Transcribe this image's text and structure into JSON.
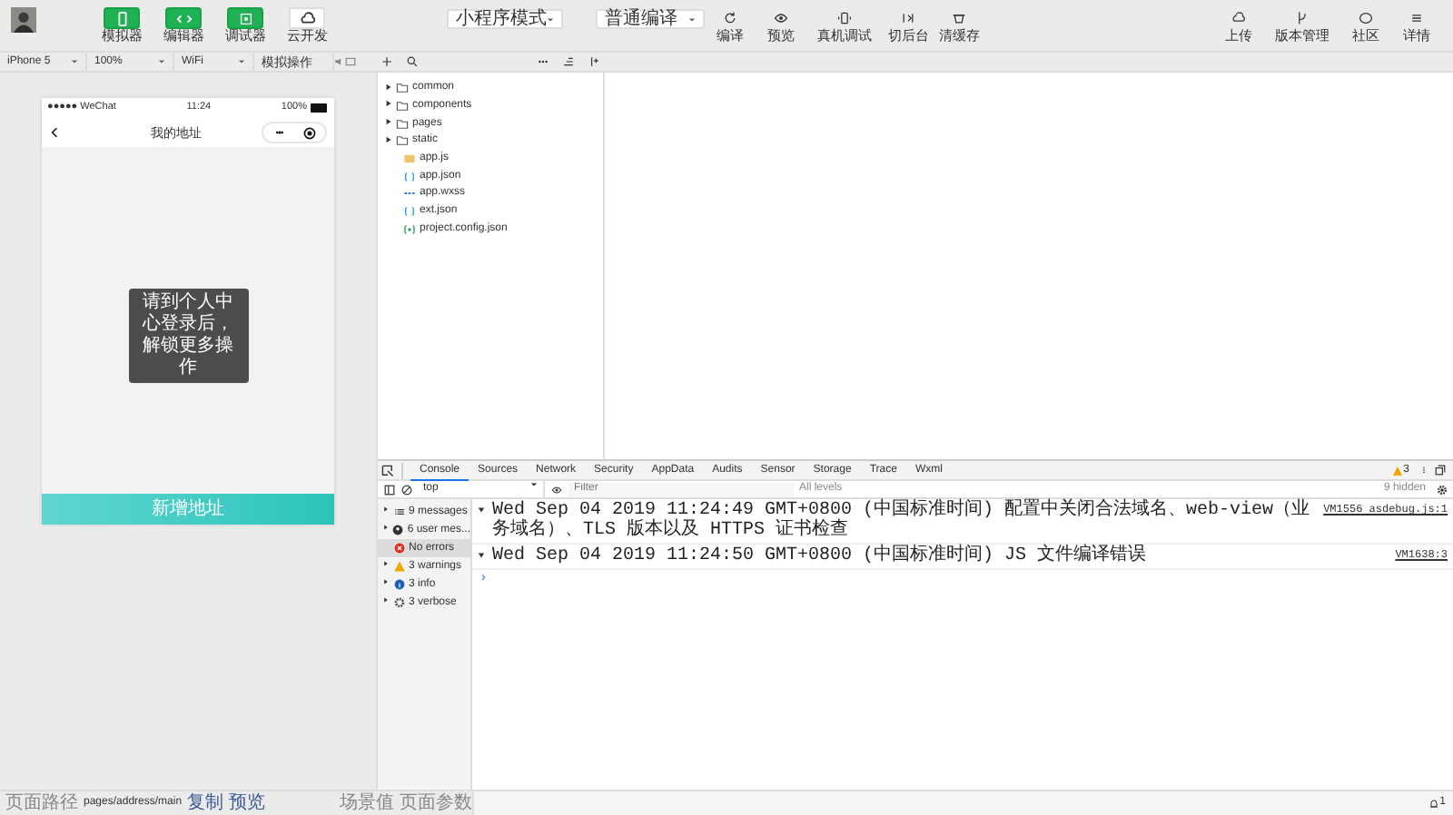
{
  "toolbar": {
    "views": [
      {
        "label": "模拟器",
        "on": true,
        "kind": "phone"
      },
      {
        "label": "编辑器",
        "on": true,
        "kind": "code"
      },
      {
        "label": "调试器",
        "on": true,
        "kind": "debug"
      },
      {
        "label": "云开发",
        "on": false,
        "kind": "cloud"
      }
    ],
    "mode": "小程序模式",
    "compile": "普通编译",
    "actions": [
      {
        "label": "编译",
        "kind": "refresh"
      },
      {
        "label": "预览",
        "kind": "eye"
      },
      {
        "label": "真机调试",
        "kind": "device"
      },
      {
        "label": "切后台",
        "kind": "switch"
      },
      {
        "label": "清缓存",
        "kind": "cache"
      }
    ],
    "right": [
      {
        "label": "上传",
        "kind": "upload"
      },
      {
        "label": "版本管理",
        "kind": "branch"
      },
      {
        "label": "社区",
        "kind": "chat"
      },
      {
        "label": "详情",
        "kind": "menu"
      }
    ]
  },
  "device_bar": [
    "iPhone 5",
    "100%",
    "WiFi",
    "模拟操作"
  ],
  "phone": {
    "carrier": "●●●●● WeChat",
    "time": "11:24",
    "battery": "100%",
    "nav_title": "我的地址",
    "toast": "请到个人中心登录后，解锁更多操作",
    "button": "新增地址"
  },
  "files": [
    {
      "name": "common",
      "kind": "folder"
    },
    {
      "name": "components",
      "kind": "folder"
    },
    {
      "name": "pages",
      "kind": "folder"
    },
    {
      "name": "static",
      "kind": "folder"
    },
    {
      "name": "app.js",
      "kind": "js"
    },
    {
      "name": "app.json",
      "kind": "json"
    },
    {
      "name": "app.wxss",
      "kind": "wxss"
    },
    {
      "name": "ext.json",
      "kind": "json"
    },
    {
      "name": "project.config.json",
      "kind": "config"
    }
  ],
  "devtools": {
    "tabs": [
      {
        "label": "Console",
        "selected": true
      },
      {
        "label": "Sources",
        "selected": false
      },
      {
        "label": "Network",
        "selected": false
      },
      {
        "label": "Security",
        "selected": false
      },
      {
        "label": "AppData",
        "selected": false
      },
      {
        "label": "Audits",
        "selected": false
      },
      {
        "label": "Sensor",
        "selected": false
      },
      {
        "label": "Storage",
        "selected": false
      },
      {
        "label": "Trace",
        "selected": false
      },
      {
        "label": "Wxml",
        "selected": false
      }
    ],
    "warning_count": "3",
    "context": "top",
    "filter_placeholder": "Filter",
    "levels": "All levels",
    "hidden": "9 hidden",
    "sidebar": [
      {
        "label": "9 messages",
        "kind": "list",
        "selected": false
      },
      {
        "label": "6 user mes...",
        "kind": "user",
        "selected": false
      },
      {
        "label": "No errors",
        "kind": "error",
        "selected": true
      },
      {
        "label": "3 warnings",
        "kind": "warning",
        "selected": false
      },
      {
        "label": "3 info",
        "kind": "info",
        "selected": false
      },
      {
        "label": "3 verbose",
        "kind": "verbose",
        "selected": false
      }
    ],
    "messages": [
      {
        "text": "Wed Sep 04 2019 11:24:49 GMT+0800 (中国标准时间) 配置中关闭合法域名、web-view（业务域名）、TLS 版本以及 HTTPS 证书检查",
        "source": "VM1556 asdebug.js:1"
      },
      {
        "text": "Wed Sep 04 2019 11:24:50 GMT+0800 (中国标准时间) JS 文件编译错误",
        "source": "VM1638:3"
      }
    ],
    "prompt": "›"
  },
  "status_bar": {
    "path_label": "页面路径",
    "path": "pages/address/main",
    "copy": "复制",
    "preview": "预览",
    "scene": "场景值",
    "params": "页面参数",
    "notifications": "1"
  }
}
